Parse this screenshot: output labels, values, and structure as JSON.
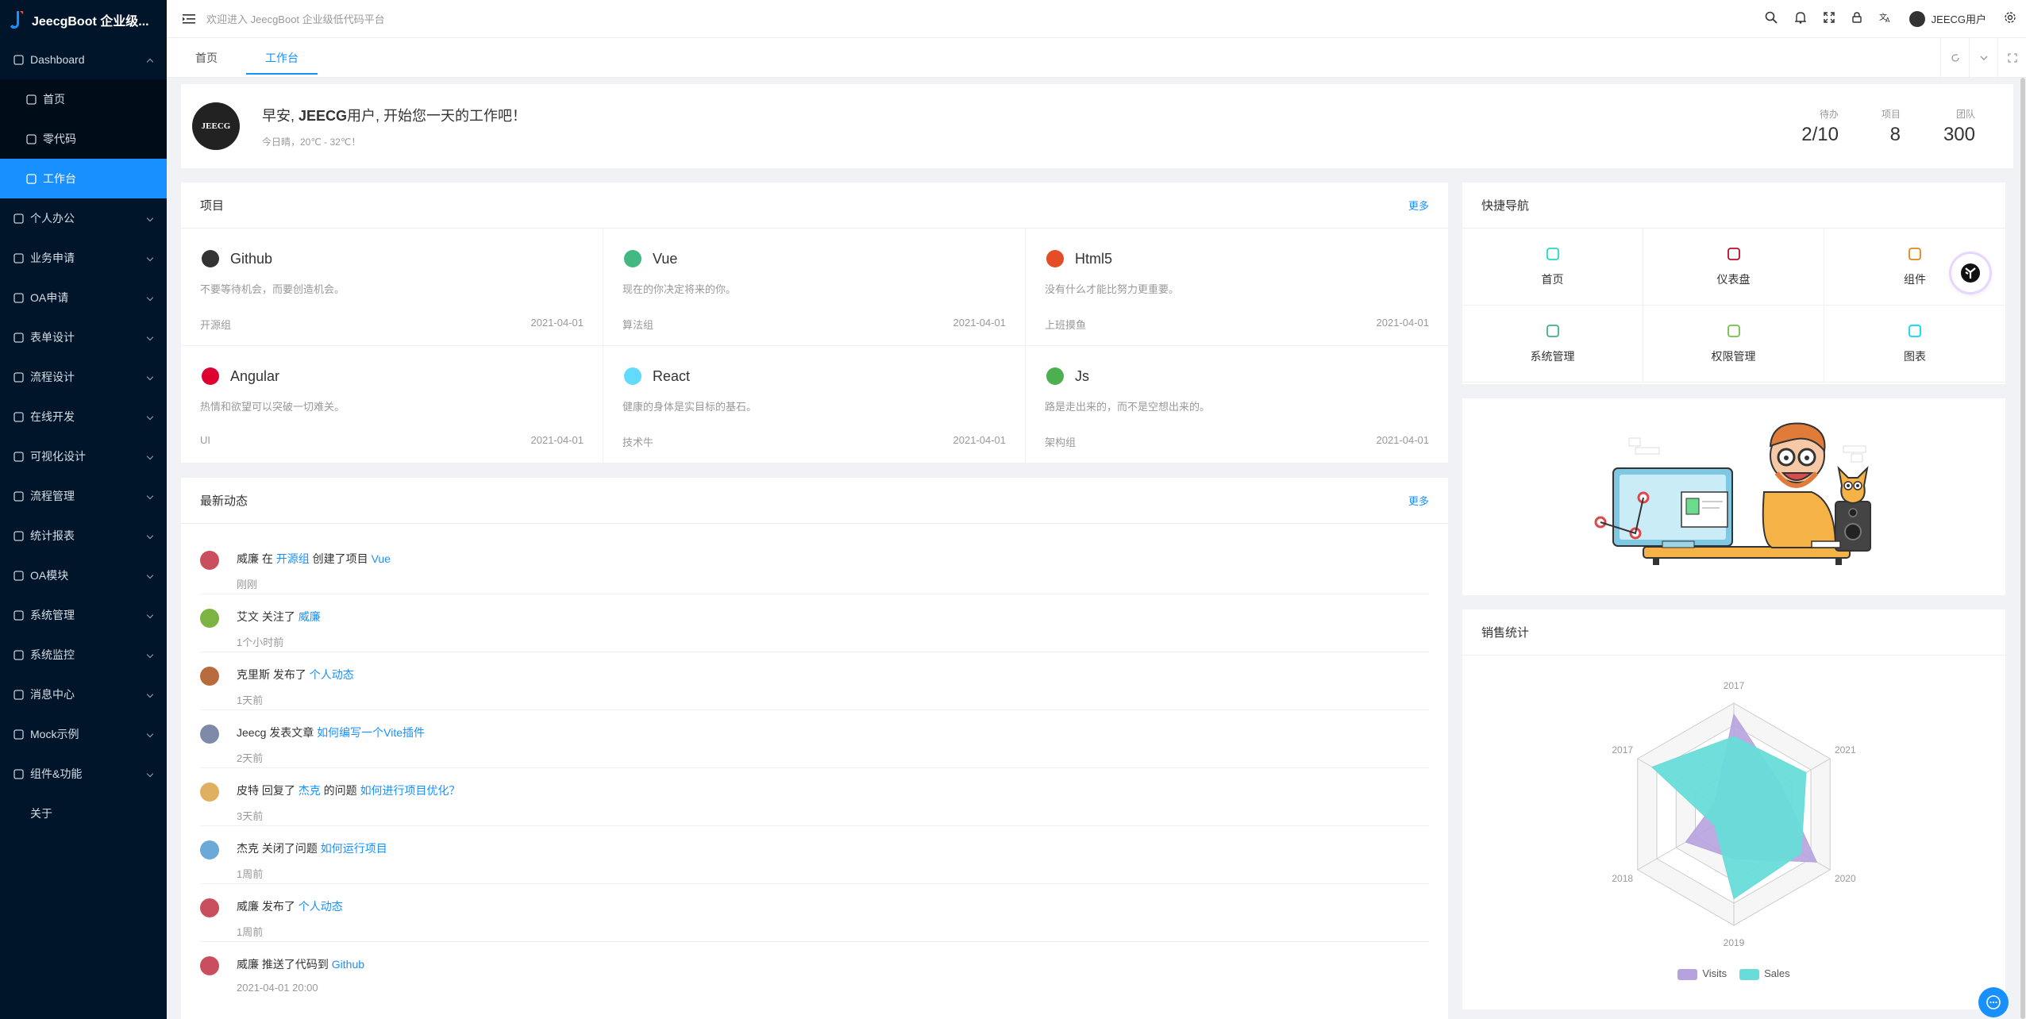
{
  "app": {
    "title": "JeecgBoot 企业级..."
  },
  "sidebar": {
    "items": [
      {
        "label": "Dashboard",
        "icon": "dashboard-icon",
        "expanded": true
      },
      {
        "label": "首页",
        "icon": "bank-icon",
        "sub": true
      },
      {
        "label": "零代码",
        "icon": "code-icon",
        "sub": true
      },
      {
        "label": "工作台",
        "icon": "workbench-icon",
        "sub": true,
        "active": true
      },
      {
        "label": "个人办公",
        "icon": "coffee-icon"
      },
      {
        "label": "业务申请",
        "icon": "tag-icon"
      },
      {
        "label": "OA申请",
        "icon": "file-icon"
      },
      {
        "label": "表单设计",
        "icon": "form-icon"
      },
      {
        "label": "流程设计",
        "icon": "flow-icon"
      },
      {
        "label": "在线开发",
        "icon": "cloud-icon"
      },
      {
        "label": "可视化设计",
        "icon": "screen-icon"
      },
      {
        "label": "流程管理",
        "icon": "process-icon"
      },
      {
        "label": "统计报表",
        "icon": "chart-icon"
      },
      {
        "label": "OA模块",
        "icon": "doc-icon"
      },
      {
        "label": "系统管理",
        "icon": "setting-icon"
      },
      {
        "label": "系统监控",
        "icon": "monitor-icon"
      },
      {
        "label": "消息中心",
        "icon": "message-icon"
      },
      {
        "label": "Mock示例",
        "icon": "gear-icon"
      },
      {
        "label": "组件&功能",
        "icon": "layers-icon"
      },
      {
        "label": "关于",
        "icon": ""
      }
    ]
  },
  "topbar": {
    "welcome": "欢迎进入 JeecgBoot 企业级低代码平台",
    "username": "JEECG用户"
  },
  "tabs": [
    {
      "label": "首页"
    },
    {
      "label": "工作台",
      "active": true
    }
  ],
  "header": {
    "avatar_text": "JEECG",
    "greeting_prefix": "早安, ",
    "greeting_name": "JEECG",
    "greeting_suffix": "用户, 开始您一天的工作吧！",
    "weather": "今日晴，20℃ - 32℃！",
    "stats": [
      {
        "label": "待办",
        "value": "2/10"
      },
      {
        "label": "项目",
        "value": "8"
      },
      {
        "label": "团队",
        "value": "300"
      }
    ]
  },
  "projects": {
    "title": "项目",
    "more": "更多",
    "items": [
      {
        "name": "Github",
        "icon": "github-icon",
        "desc": "不要等待机会，而要创造机会。",
        "group": "开源组",
        "date": "2021-04-01",
        "color": "#333333"
      },
      {
        "name": "Vue",
        "icon": "vue-icon",
        "desc": "现在的你决定将来的你。",
        "group": "算法组",
        "date": "2021-04-01",
        "color": "#42b883"
      },
      {
        "name": "Html5",
        "icon": "html5-icon",
        "desc": "没有什么才能比努力更重要。",
        "group": "上班摸鱼",
        "date": "2021-04-01",
        "color": "#e44d26"
      },
      {
        "name": "Angular",
        "icon": "angular-icon",
        "desc": "热情和欲望可以突破一切难关。",
        "group": "UI",
        "date": "2021-04-01",
        "color": "#dd0031"
      },
      {
        "name": "React",
        "icon": "react-icon",
        "desc": "健康的身体是实目标的基石。",
        "group": "技术牛",
        "date": "2021-04-01",
        "color": "#61dafb"
      },
      {
        "name": "Js",
        "icon": "js-icon",
        "desc": "路是走出来的，而不是空想出来的。",
        "group": "架构组",
        "date": "2021-04-01",
        "color": "#4caf50"
      }
    ]
  },
  "activity": {
    "title": "最新动态",
    "more": "更多",
    "items": [
      {
        "pre": "威廉 在 ",
        "l1": "开源组",
        "mid": " 创建了项目 ",
        "l2": "Vue",
        "time": "刚刚",
        "avatar_color": "#c94f5e"
      },
      {
        "pre": "艾文 关注了 ",
        "l1": "威廉",
        "mid": "",
        "l2": "",
        "time": "1个小时前",
        "avatar_color": "#7cb342"
      },
      {
        "pre": "克里斯 发布了 ",
        "l1": "个人动态",
        "mid": "",
        "l2": "",
        "time": "1天前",
        "avatar_color": "#b86b3c"
      },
      {
        "pre": "Jeecg 发表文章 ",
        "l1": "如何编写一个Vite插件",
        "mid": "",
        "l2": "",
        "time": "2天前",
        "avatar_color": "#7e8aa8"
      },
      {
        "pre": "皮特 回复了 ",
        "l1": "杰克",
        "mid": " 的问题 ",
        "l2": "如何进行项目优化？",
        "time": "3天前",
        "avatar_color": "#e0b060"
      },
      {
        "pre": "杰克 关闭了问题 ",
        "l1": "如何运行项目",
        "mid": "",
        "l2": "",
        "time": "1周前",
        "avatar_color": "#6aa9d8"
      },
      {
        "pre": "威廉 发布了 ",
        "l1": "个人动态",
        "mid": "",
        "l2": "",
        "time": "1周前",
        "avatar_color": "#c94f5e"
      },
      {
        "pre": "威廉 推送了代码到 ",
        "l1": "Github",
        "mid": "",
        "l2": "",
        "time": "2021-04-01 20:00",
        "avatar_color": "#c94f5e"
      }
    ]
  },
  "quicknav": {
    "title": "快捷导航",
    "items": [
      {
        "label": "首页",
        "icon": "home-icon",
        "color": "#1fdaca"
      },
      {
        "label": "仪表盘",
        "icon": "dashboard-icon",
        "color": "#bf0c2c"
      },
      {
        "label": "组件",
        "icon": "layers-icon",
        "color": "#e18525"
      },
      {
        "label": "系统管理",
        "icon": "setting-icon",
        "color": "#3fb27f"
      },
      {
        "label": "权限管理",
        "icon": "key-icon",
        "color": "#4daf1bc9"
      },
      {
        "label": "图表",
        "icon": "chart-icon",
        "color": "#00d8ff"
      }
    ]
  },
  "sales": {
    "title": "销售统计"
  },
  "chart_data": {
    "type": "radar",
    "indicators": [
      "2017",
      "2021",
      "2020",
      "2019",
      "2018",
      "2017"
    ],
    "max": 100,
    "series": [
      {
        "name": "Visits",
        "values": [
          90,
          50,
          86,
          40,
          50,
          20
        ],
        "color": "#b6a2de"
      },
      {
        "name": "Sales",
        "values": [
          70,
          75,
          70,
          76,
          20,
          85
        ],
        "color": "#5ab1ef"
      }
    ],
    "legend_position": "bottom"
  }
}
